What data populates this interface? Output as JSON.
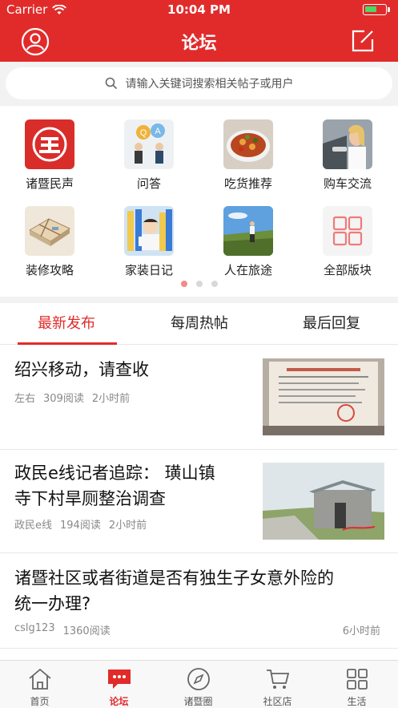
{
  "status_bar": {
    "carrier": "Carrier",
    "time": "10:04 PM",
    "battery_level": 0.6
  },
  "nav": {
    "title": "论坛",
    "profile_icon": "user-circle-icon",
    "compose_icon": "compose-icon"
  },
  "search": {
    "placeholder": "请输入关键词搜索相关帖子或用户",
    "icon": "search-icon"
  },
  "categories": [
    {
      "label": "诸暨民声",
      "icon": "zhuji-minsheng-logo"
    },
    {
      "label": "问答",
      "icon": "qa-icon"
    },
    {
      "label": "吃货推荐",
      "icon": "food-icon"
    },
    {
      "label": "购车交流",
      "icon": "car-icon"
    },
    {
      "label": "装修攻略",
      "icon": "floorplan-icon"
    },
    {
      "label": "家装日记",
      "icon": "home-diary-icon"
    },
    {
      "label": "人在旅途",
      "icon": "travel-icon"
    },
    {
      "label": "全部版块",
      "icon": "grid-icon"
    }
  ],
  "pager": {
    "pages": 3,
    "active": 1
  },
  "tabs": [
    {
      "label": "最新发布",
      "active": true
    },
    {
      "label": "每周热帖",
      "active": false
    },
    {
      "label": "最后回复",
      "active": false
    }
  ],
  "posts": [
    {
      "title_lines": [
        "绍兴移动，请查收"
      ],
      "author": "左右",
      "views": "309阅读",
      "time": "2小时前",
      "has_thumb": true
    },
    {
      "title_lines": [
        "政民e线记者追踪： 璜山镇",
        "寺下村旱厕整治调查"
      ],
      "author": "政民e线",
      "views": "194阅读",
      "time": "2小时前",
      "has_thumb": true
    },
    {
      "title_lines": [
        "诸暨社区或者街道是否有独生子女意外险的",
        "统一办理?"
      ],
      "author": "cslg123",
      "views": "1360阅读",
      "time": "6小时前",
      "has_thumb": false
    }
  ],
  "tabbar": [
    {
      "label": "首页",
      "icon": "home-icon",
      "active": false
    },
    {
      "label": "论坛",
      "icon": "forum-chat-icon",
      "active": true
    },
    {
      "label": "诸暨圈",
      "icon": "compass-icon",
      "active": false
    },
    {
      "label": "社区店",
      "icon": "cart-icon",
      "active": false
    },
    {
      "label": "生活",
      "icon": "grid-icon",
      "active": false
    }
  ],
  "colors": {
    "brand": "#e12b2b",
    "muted": "#888888",
    "page_gray": "#f2f2f2"
  }
}
